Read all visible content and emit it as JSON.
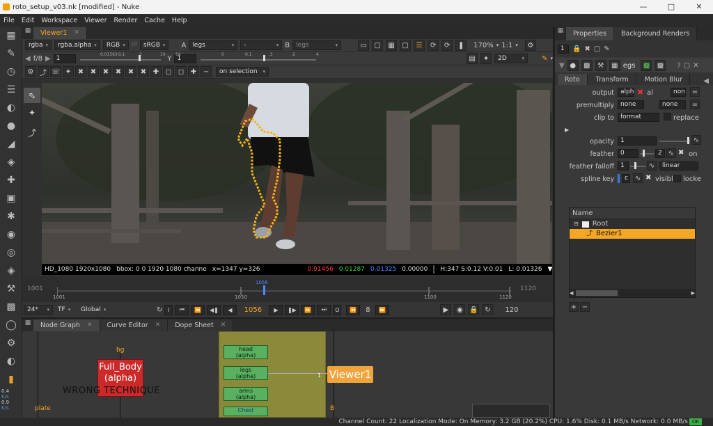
{
  "window": {
    "title": "roto_setup_v03.nk [modified] - Nuke"
  },
  "menu": [
    "File",
    "Edit",
    "Workspace",
    "Viewer",
    "Render",
    "Cache",
    "Help"
  ],
  "viewer_tab": {
    "label": "Viewer1"
  },
  "viewer_controls": {
    "channels": "rgba",
    "channel_alpha": "rgba.alpha",
    "colorspace_mode": "RGB",
    "ip": "IP",
    "lut": "sRGB",
    "a_label": "A",
    "a_input": "legs",
    "blend": "-",
    "b_label": "B",
    "b_input": "legs",
    "zoom": "170%",
    "ratio": "1:1",
    "fstop": "f/8",
    "gain": "1",
    "gain_ticks": [
      "0.01563",
      "0.1",
      "1",
      "10",
      "64"
    ],
    "y_label": "Y",
    "gamma": "1",
    "gamma_ticks": [
      "0",
      "0.1",
      ".3",
      "2",
      "4"
    ],
    "view_mode": "2D"
  },
  "roto_toolbar": {
    "selection_mode": "on selection"
  },
  "info_bar": {
    "format": "HD_1080 1920x1080",
    "bbox": "bbox: 0 0 1920 1080 channe",
    "coords": "x=1347 y=326",
    "r": "0.01456",
    "g": "0.01287",
    "b": "0.01325",
    "a": "0.00000",
    "hsv": "H:347 S:0.12 V:0.01",
    "luma": "L: 0.01326"
  },
  "timeline": {
    "in_frame": "1001",
    "out_frame": "1120",
    "ticks": [
      "1001",
      "1050",
      "1100",
      "1120"
    ],
    "playhead_label": "1056",
    "fps": "24*",
    "tf": "TF",
    "scope": "Global",
    "current_frame": "1056",
    "step": "8",
    "end_frame": "120",
    "i_label": "I",
    "o_label": "O"
  },
  "bottom_tabs": [
    "Node Graph",
    "Curve Editor",
    "Dope Sheet"
  ],
  "node_graph": {
    "bg_label": "bg",
    "plate_label": "plate",
    "b_label": "B",
    "red_node": "Full_Body\n(alpha)",
    "warning": "WRONG TECHNIQUE",
    "nodes": [
      {
        "name": "head\n(alpha)"
      },
      {
        "name": "legs\n(alpha)"
      },
      {
        "name": "arms\n(alpha)"
      },
      {
        "name": "Chest"
      }
    ],
    "viewer_node": "Viewer1",
    "viewer_input": "1"
  },
  "properties": {
    "tabs": [
      "Properties",
      "Background Renders"
    ],
    "count": "1",
    "node_name": "egs",
    "subtabs": [
      "Roto",
      "Transform",
      "Motion Blur"
    ],
    "output_label": "output",
    "output_value": "alph",
    "output_extra": "al",
    "output_none": "non",
    "premultiply_label": "premultiply",
    "premultiply_value": "none",
    "premultiply_value2": "none",
    "clipto_label": "clip to",
    "clipto_value": "format",
    "replace_label": "replace",
    "opacity_label": "opacity",
    "opacity_value": "1",
    "feather_label": "feather",
    "feather_value": "0",
    "feather_on_value": "2",
    "feather_on_label": "on",
    "falloff_label": "feather falloff",
    "falloff_value": "1",
    "falloff_type": "linear",
    "splinekey_label": "spline key",
    "splinekey_c": "c",
    "visible_label": "visibl",
    "locked_label": "locke",
    "tree_header": "Name",
    "tree_root": "Root",
    "tree_item": "Bezier1"
  },
  "status": {
    "text": "Channel Count: 22  Localization Mode: On  Memory: 3.2 GB (20.2%) CPU: 1.6% Disk: 0.1 MB/s Network: 0.0 MB/s",
    "ok": "OK"
  },
  "toolbar_readout": {
    "line1": "0.4",
    "line2": "K/s",
    "line3": "0.9",
    "line4": "K/s"
  },
  "colors": {
    "accent": "#f5a623",
    "roto_spline": "#f2b21c",
    "node_green": "#58b060",
    "node_red": "#cc2a2a",
    "backdrop": "#8a8a3a"
  }
}
